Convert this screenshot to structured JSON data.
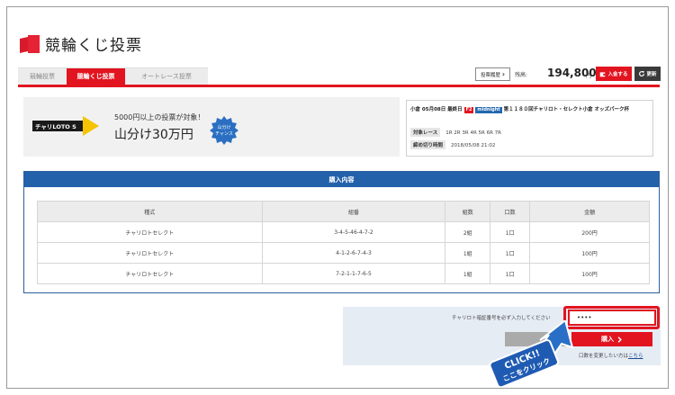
{
  "header": {
    "title": "競輪くじ投票"
  },
  "tabs": [
    {
      "label": "競輪投票"
    },
    {
      "label": "競輪くじ投票"
    },
    {
      "label": "オートレース投票"
    }
  ],
  "account": {
    "history_label": "投票履歴",
    "history_arrow": "›",
    "balance_label": "残高:",
    "balance_value": "194,800",
    "balance_unit": "円",
    "deposit_label": "入金する",
    "update_label": "更新"
  },
  "banner": {
    "logo_text": "チャリLOTO S",
    "sub": "5000円以上の投票が対象！",
    "main": "山分け30万円",
    "badge_line1": "山分け",
    "badge_line2": "チャンス"
  },
  "race": {
    "venue_date": "小倉 05月08日 最終日",
    "grade_tag": "F2",
    "night_tag": "midnight",
    "race_name": "第１１８０回チャリロト・セレクト小倉 オッズパーク杯",
    "target_label": "対象レース",
    "target_value": "1R 2R 3R 4R 5R 6R 7R",
    "deadline_label": "締め切り時間",
    "deadline_value": "2018/05/08 21:02"
  },
  "purchase": {
    "title": "購入内容",
    "columns": [
      "種式",
      "組番",
      "組数",
      "口数",
      "金額"
    ],
    "rows": [
      [
        "チャリロトセレクト",
        "3-4-5-46-4-7-2",
        "2組",
        "1口",
        "200円"
      ],
      [
        "チャリロトセレクト",
        "4-1-2-6-7-4-3",
        "1組",
        "1口",
        "100円"
      ],
      [
        "チャリロトセレクト",
        "7-2-1-1-7-6-5",
        "1組",
        "1口",
        "100円"
      ]
    ]
  },
  "confirm": {
    "pin_label": "チャリロト暗証番号を必ず入力してください",
    "pin_value": "••••",
    "buy_label": "購入",
    "change_text": "口数を変更したい方は",
    "change_link": "こちら"
  },
  "annotation": {
    "line1": "CLICK!!",
    "line2": "ここをクリック"
  },
  "colors": {
    "brand_red": "#e1141f",
    "panel_blue": "#2361ab"
  }
}
